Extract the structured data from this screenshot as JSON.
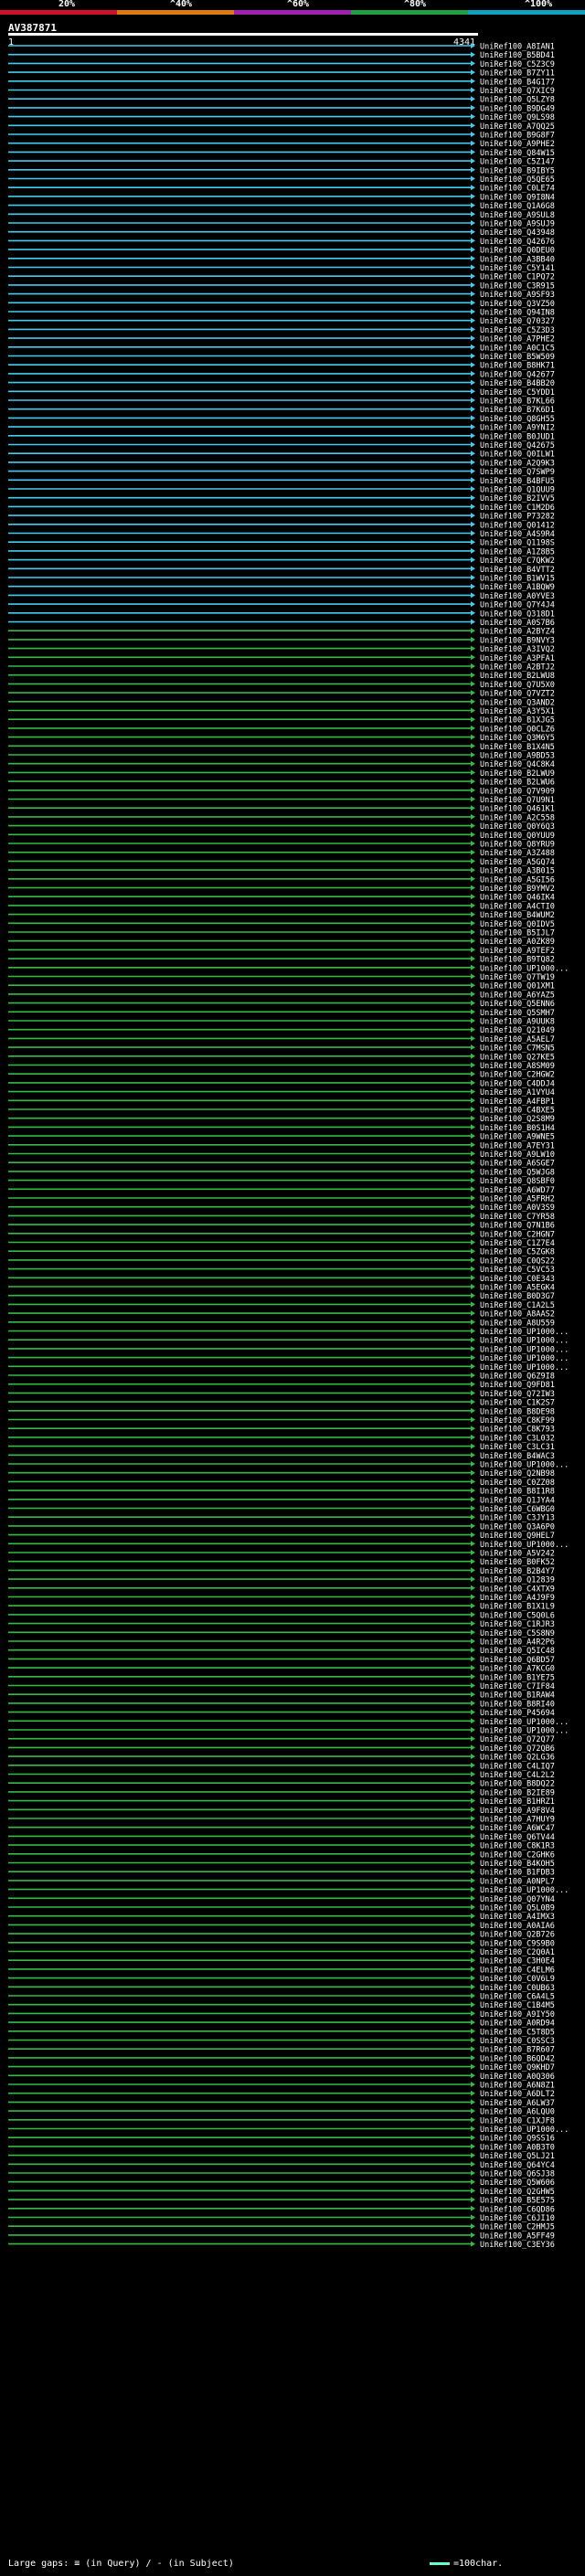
{
  "legend": {
    "labels": [
      "20%",
      "^40%",
      "^60%",
      "^80%",
      "^100%"
    ],
    "colors": [
      "#d0102a",
      "#e07a10",
      "#a020b0",
      "#20a040",
      "#10a0c0"
    ]
  },
  "query": {
    "id": "AV387871",
    "start": "1",
    "end": "4341"
  },
  "hit_colors": {
    "cyan": "#44ccee",
    "green": "#33bb44"
  },
  "hits": [
    "UniRef100_A8IAN1",
    "UniRef100_B5BD41",
    "UniRef100_C5Z3C9",
    "UniRef100_B7ZY11",
    "UniRef100_B4G177",
    "UniRef100_Q7XIC9",
    "UniRef100_Q5LZY8",
    "UniRef100_B9DG49",
    "UniRef100_Q9LS98",
    "UniRef100_A7QQ25",
    "UniRef100_B9G8F7",
    "UniRef100_A9PHE2",
    "UniRef100_Q84W15",
    "UniRef100_C5Z147",
    "UniRef100_B9IBY5",
    "UniRef100_Q5QE65",
    "UniRef100_C0LE74",
    "UniRef100_Q9I8N4",
    "UniRef100_Q1A6G8",
    "UniRef100_A9SUL8",
    "UniRef100_A9SUJ9",
    "UniRef100_Q43948",
    "UniRef100_Q42676",
    "UniRef100_Q0DEU0",
    "UniRef100_A3BB40",
    "UniRef100_C5Y141",
    "UniRef100_C1PQ72",
    "UniRef100_C3R915",
    "UniRef100_A9SF93",
    "UniRef100_Q3VZ50",
    "UniRef100_Q94IN8",
    "UniRef100_Q70327",
    "UniRef100_C5Z3D3",
    "UniRef100_A7PHE2",
    "UniRef100_A0C1C5",
    "UniRef100_B5W509",
    "UniRef100_B8HK71",
    "UniRef100_Q42677",
    "UniRef100_B4BB20",
    "UniRef100_C5YDD1",
    "UniRef100_B7KL66",
    "UniRef100_B7K6D1",
    "UniRef100_Q8GH55",
    "UniRef100_A9YNI2",
    "UniRef100_B0JUD1",
    "UniRef100_Q42675",
    "UniRef100_Q0ILW1",
    "UniRef100_A2Q9K3",
    "UniRef100_Q7SWP9",
    "UniRef100_B4BFU5",
    "UniRef100_Q1QUU9",
    "UniRef100_B2IVV5",
    "UniRef100_C1M2D6",
    "UniRef100_P73282",
    "UniRef100_Q01412",
    "UniRef100_A4S9R4",
    "UniRef100_Q1198S",
    "UniRef100_A1Z8B5",
    "UniRef100_C7QKW2",
    "UniRef100_B4VTT2",
    "UniRef100_B1WV15",
    "UniRef100_A1BQW9",
    "UniRef100_A0YVE3",
    "UniRef100_Q7Y4J4",
    "UniRef100_Q318D1",
    "UniRef100_A0S7B6",
    "UniRef100_A2BYZ4",
    "UniRef100_B9NVY3",
    "UniRef100_A3IVQ2",
    "UniRef100_A3PFA1",
    "UniRef100_A2BTJ2",
    "UniRef100_B2LWU8",
    "UniRef100_Q7U5X0",
    "UniRef100_Q7VZT2",
    "UniRef100_Q3AND2",
    "UniRef100_A3Y5X1",
    "UniRef100_B1XJG5",
    "UniRef100_Q0CLZ6",
    "UniRef100_Q3M6Y5",
    "UniRef100_B1X4N5",
    "UniRef100_A9BD53",
    "UniRef100_Q4C8K4",
    "UniRef100_B2LWU9",
    "UniRef100_B2LWU6",
    "UniRef100_Q7V909",
    "UniRef100_Q7U9N1",
    "UniRef100_Q461K1",
    "UniRef100_A2C558",
    "UniRef100_Q0Y6Q3",
    "UniRef100_Q0YUU9",
    "UniRef100_Q8YRU9",
    "UniRef100_A3Z488",
    "UniRef100_A5GQ74",
    "UniRef100_A3B015",
    "UniRef100_A5GI56",
    "UniRef100_B9YMV2",
    "UniRef100_Q46IK4",
    "UniRef100_A4CTI0",
    "UniRef100_B4WUM2",
    "UniRef100_Q0IDV5",
    "UniRef100_B5IJL7",
    "UniRef100_A0ZK89",
    "UniRef100_A9TEF2",
    "UniRef100_B9TQ82",
    "UniRef100_UP1000...",
    "UniRef100_Q7TW19",
    "UniRef100_Q01XM1",
    "UniRef100_A6YAZ5",
    "UniRef100_Q5ENN6",
    "UniRef100_Q5SMH7",
    "UniRef100_A9UUK8",
    "UniRef100_Q21049",
    "UniRef100_A5AEL7",
    "UniRef100_C7MSN5",
    "UniRef100_Q27KE5",
    "UniRef100_A8SM09",
    "UniRef100_C2HGW2",
    "UniRef100_C4DDJ4",
    "UniRef100_A1VYU4",
    "UniRef100_A4FBP1",
    "UniRef100_C4BXE5",
    "UniRef100_Q2S8M9",
    "UniRef100_B0S1H4",
    "UniRef100_A9WNE5",
    "UniRef100_A7EY31",
    "UniRef100_A9LW10",
    "UniRef100_A6SGE7",
    "UniRef100_Q5WJG8",
    "UniRef100_Q8SBF0",
    "UniRef100_A6WD77",
    "UniRef100_A5FRH2",
    "UniRef100_A0V3S9",
    "UniRef100_C7YR58",
    "UniRef100_Q7N1B6",
    "UniRef100_C2HGN7",
    "UniRef100_C1Z7E4",
    "UniRef100_C5ZGK8",
    "UniRef100_C0QS22",
    "UniRef100_C5VC53",
    "UniRef100_C0E343",
    "UniRef100_A5EGK4",
    "UniRef100_B0D3G7",
    "UniRef100_C1A2L5",
    "UniRef100_A8AAS2",
    "UniRef100_A8U559",
    "UniRef100_UP1000...",
    "UniRef100_UP1000...",
    "UniRef100_UP1000...",
    "UniRef100_UP1000...",
    "UniRef100_UP1000...",
    "UniRef100_Q6Z9I8",
    "UniRef100_Q9FD81",
    "UniRef100_Q72IW3",
    "UniRef100_C1K2S7",
    "UniRef100_B8DE98",
    "UniRef100_C8KF99",
    "UniRef100_C8K793",
    "UniRef100_C3L032",
    "UniRef100_C3LC31",
    "UniRef100_B4WAC3",
    "UniRef100_UP1000...",
    "UniRef100_Q2NB98",
    "UniRef100_C0ZZ08",
    "UniRef100_B8I1R8",
    "UniRef100_Q1JYA4",
    "UniRef100_C6WBG0",
    "UniRef100_C3JY13",
    "UniRef100_Q3A6P0",
    "UniRef100_Q9HEL7",
    "UniRef100_UP1000...",
    "UniRef100_A5V242",
    "UniRef100_B0FK52",
    "UniRef100_B2B4Y7",
    "UniRef100_Q12839",
    "UniRef100_C4XTX9",
    "UniRef100_A4J9F9",
    "UniRef100_B1X1L9",
    "UniRef100_C5Q0L6",
    "UniRef100_C1RJR3",
    "UniRef100_C5S8N9",
    "UniRef100_A4R2P6",
    "UniRef100_Q5IC48",
    "UniRef100_Q6BD57",
    "UniRef100_A7KCG0",
    "UniRef100_B1YE75",
    "UniRef100_C7IF84",
    "UniRef100_B1RAW4",
    "UniRef100_B8RI40",
    "UniRef100_P45694",
    "UniRef100_UP1000...",
    "UniRef100_UP1000...",
    "UniRef100_Q72Q77",
    "UniRef100_Q72QB6",
    "UniRef100_Q2LG36",
    "UniRef100_C4LIQ7",
    "UniRef100_C4L2L2",
    "UniRef100_B8DQ22",
    "UniRef100_B2IE89",
    "UniRef100_B1HRZ1",
    "UniRef100_A9F8V4",
    "UniRef100_A7HUY9",
    "UniRef100_A6WC47",
    "UniRef100_Q6TV44",
    "UniRef100_C8K1R3",
    "UniRef100_C2GHK6",
    "UniRef100_B4KOH5",
    "UniRef100_B1FDB3",
    "UniRef100_A0NPL7",
    "UniRef100_UP1000...",
    "UniRef100_Q07YN4",
    "UniRef100_Q5L0B9",
    "UniRef100_A4IMX3",
    "UniRef100_A0AIA6",
    "UniRef100_Q2B726",
    "UniRef100_C9S9B0",
    "UniRef100_C2Q0A1",
    "UniRef100_C3H0E4",
    "UniRef100_C4ELM6",
    "UniRef100_C0V6L9",
    "UniRef100_C0UB63",
    "UniRef100_C6A4L5",
    "UniRef100_C1B4M5",
    "UniRef100_A9IY50",
    "UniRef100_A0RD94",
    "UniRef100_C5T8D5",
    "UniRef100_C0SSC3",
    "UniRef100_B7R607",
    "UniRef100_B6QD42",
    "UniRef100_Q9KHD7",
    "UniRef100_A0Q306",
    "UniRef100_A6N8Z1",
    "UniRef100_A6DLT2",
    "UniRef100_A6LW37",
    "UniRef100_A6LQU0",
    "UniRef100_C1XJF8",
    "UniRef100_UP1000...",
    "UniRef100_Q9SS16",
    "UniRef100_A0B3T0",
    "UniRef100_Q5LJ21",
    "UniRef100_Q64YC4",
    "UniRef100_Q6SJ38",
    "UniRef100_Q5W606",
    "UniRef100_Q2GHW5",
    "UniRef100_B5E575",
    "UniRef100_C6QD86",
    "UniRef100_C6JI10",
    "UniRef100_C2HMJ5",
    "UniRef100_A5FF49",
    "UniRef100_C3EY36"
  ],
  "bottom": {
    "text": "Large gaps: ≡ (in Query) / - (in Subject)",
    "scale": "=100char."
  }
}
